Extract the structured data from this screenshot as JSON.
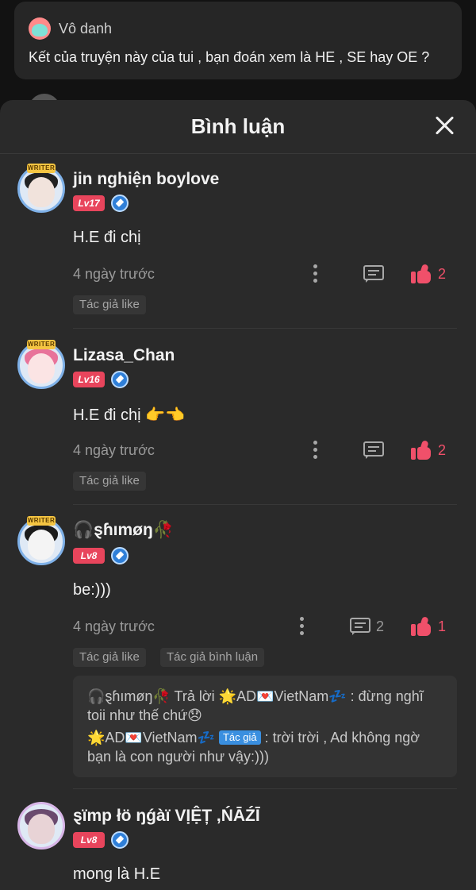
{
  "post": {
    "author": "Vô danh",
    "text": "Kết của truyện này của tui , bạn đoán xem là HE , SE hay OE ?"
  },
  "sheet": {
    "title": "Bình luận"
  },
  "comments": [
    {
      "username": "jin nghiện boylove",
      "level": "Lv17",
      "text": "H.E đi chị",
      "time": "4 ngày trước",
      "reply_count": "",
      "like_count": "2",
      "tags": [
        "Tác giả like"
      ]
    },
    {
      "username": "Lizasa_Chan",
      "level": "Lv16",
      "text": "H.E đi chị 👉👈",
      "time": "4 ngày trước",
      "reply_count": "",
      "like_count": "2",
      "tags": [
        "Tác giả like"
      ]
    },
    {
      "username": "🎧ȿɦımøŋ🥀",
      "level": "Lv8",
      "text": "be:)))",
      "time": "4 ngày trước",
      "reply_count": "2",
      "like_count": "1",
      "tags": [
        "Tác giả like",
        "Tác giả bình luận"
      ],
      "replies": [
        {
          "from": "🎧ȿɦımøŋ🥀",
          "action": "Trả lời",
          "to": "🌟AD💌VietNam💤",
          "text": ": đừng nghĩ toii như thế chứ😞"
        },
        {
          "from": "🌟AD💌VietNam💤",
          "author_chip": "Tác giả",
          "text": ": trời trời , Ad không ngờ bạn là con người như vậy:)))"
        }
      ]
    },
    {
      "username": "ȿïmp łö ŋǵàï VỊỆȚ ,ŃĀŹĪ",
      "level": "Lv8",
      "text": "mong là H.E"
    }
  ],
  "writer_badge": "WRITER",
  "colors": {
    "accent_like": "#f0506a",
    "level_badge": "#e8455c",
    "author_chip": "#3a8fe0",
    "sheet_bg": "#2a2a2a"
  }
}
